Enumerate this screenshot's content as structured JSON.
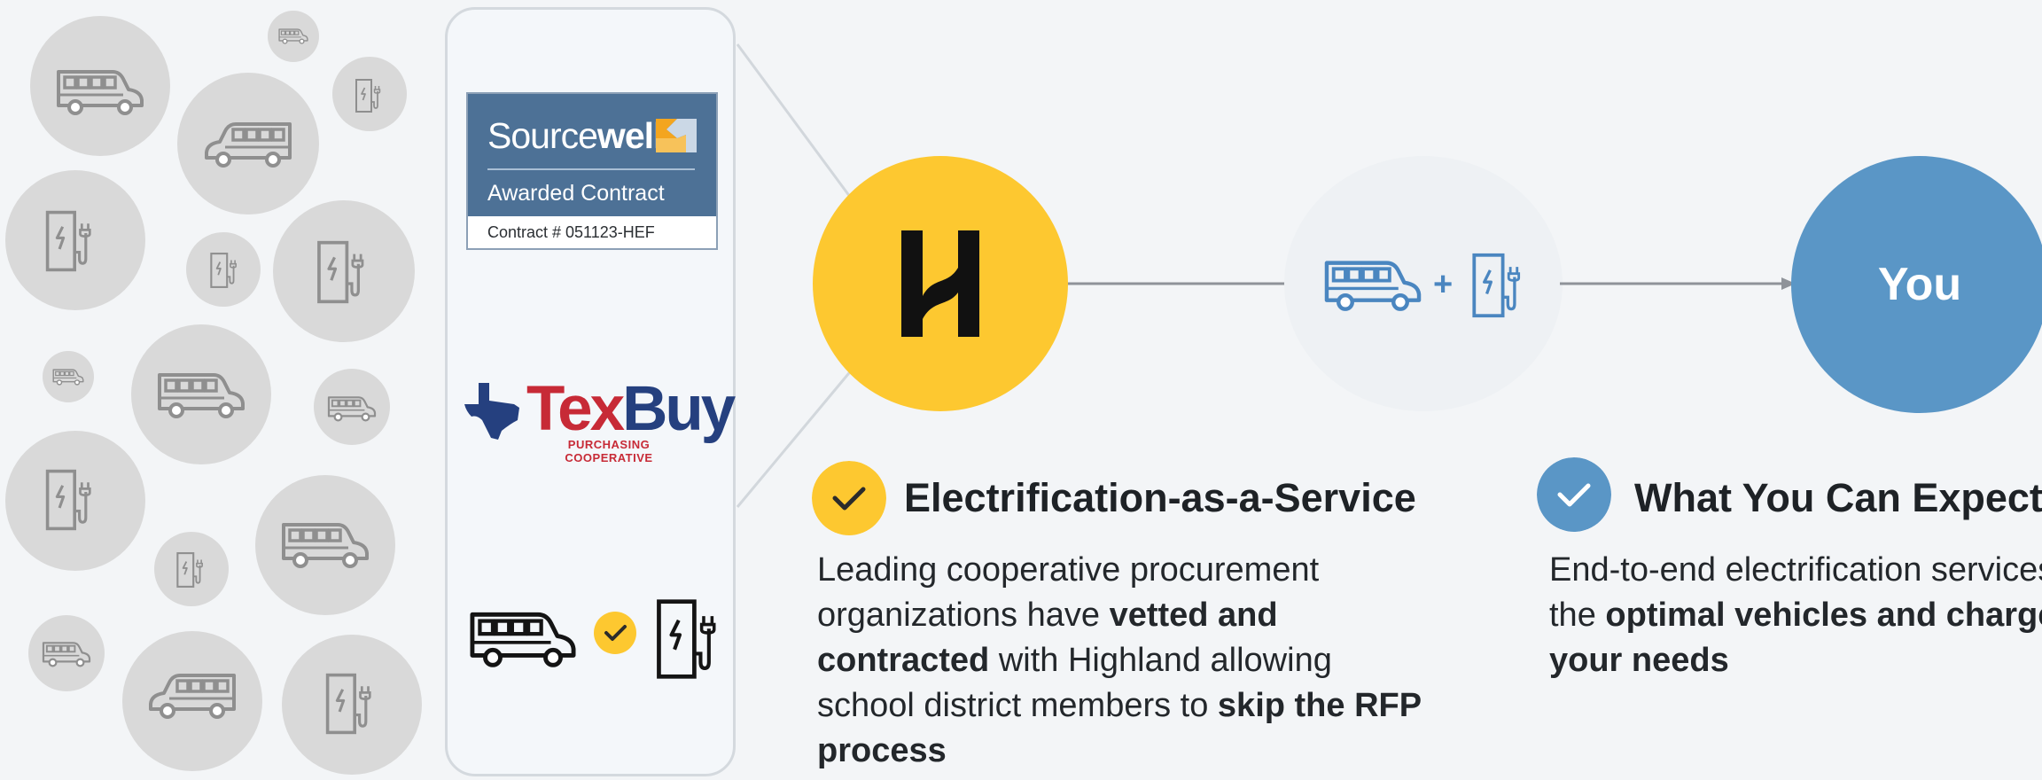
{
  "colors": {
    "background": "#f3f5f7",
    "highland_yellow": "#fdc830",
    "you_blue": "#5a96c6",
    "flow_icons_blue": "#4a86c0",
    "sourcewell_blue": "#4d7196",
    "texbuy_red": "#c72a36",
    "texbuy_navy": "#25407f"
  },
  "sourcewell": {
    "name_light": "Source",
    "name_bold": "well",
    "awarded": "Awarded Contract",
    "contract": "Contract # 051123-HEF"
  },
  "texbuy": {
    "tex": "Tex",
    "buy": "Buy",
    "subtitle": "PURCHASING COOPERATIVE"
  },
  "flow": {
    "plus": "+",
    "target": "You"
  },
  "eaas": {
    "heading": "Electrification-as-a-Service",
    "parts": [
      "Leading cooperative procurement organizations have ",
      "vetted and contracted",
      " with Highland allowing school district members to ",
      "skip the RFP process"
    ]
  },
  "expect": {
    "heading": "What You Can Expect",
    "parts": [
      "End-to-end electrification services with the ",
      "optimal vehicles and chargers for your needs"
    ]
  },
  "icons": [
    "bus-icon",
    "charger-icon",
    "check-icon",
    "highland-logo-icon",
    "texas-map-icon",
    "sourcewell-mark-icon",
    "arrow-right-icon"
  ]
}
